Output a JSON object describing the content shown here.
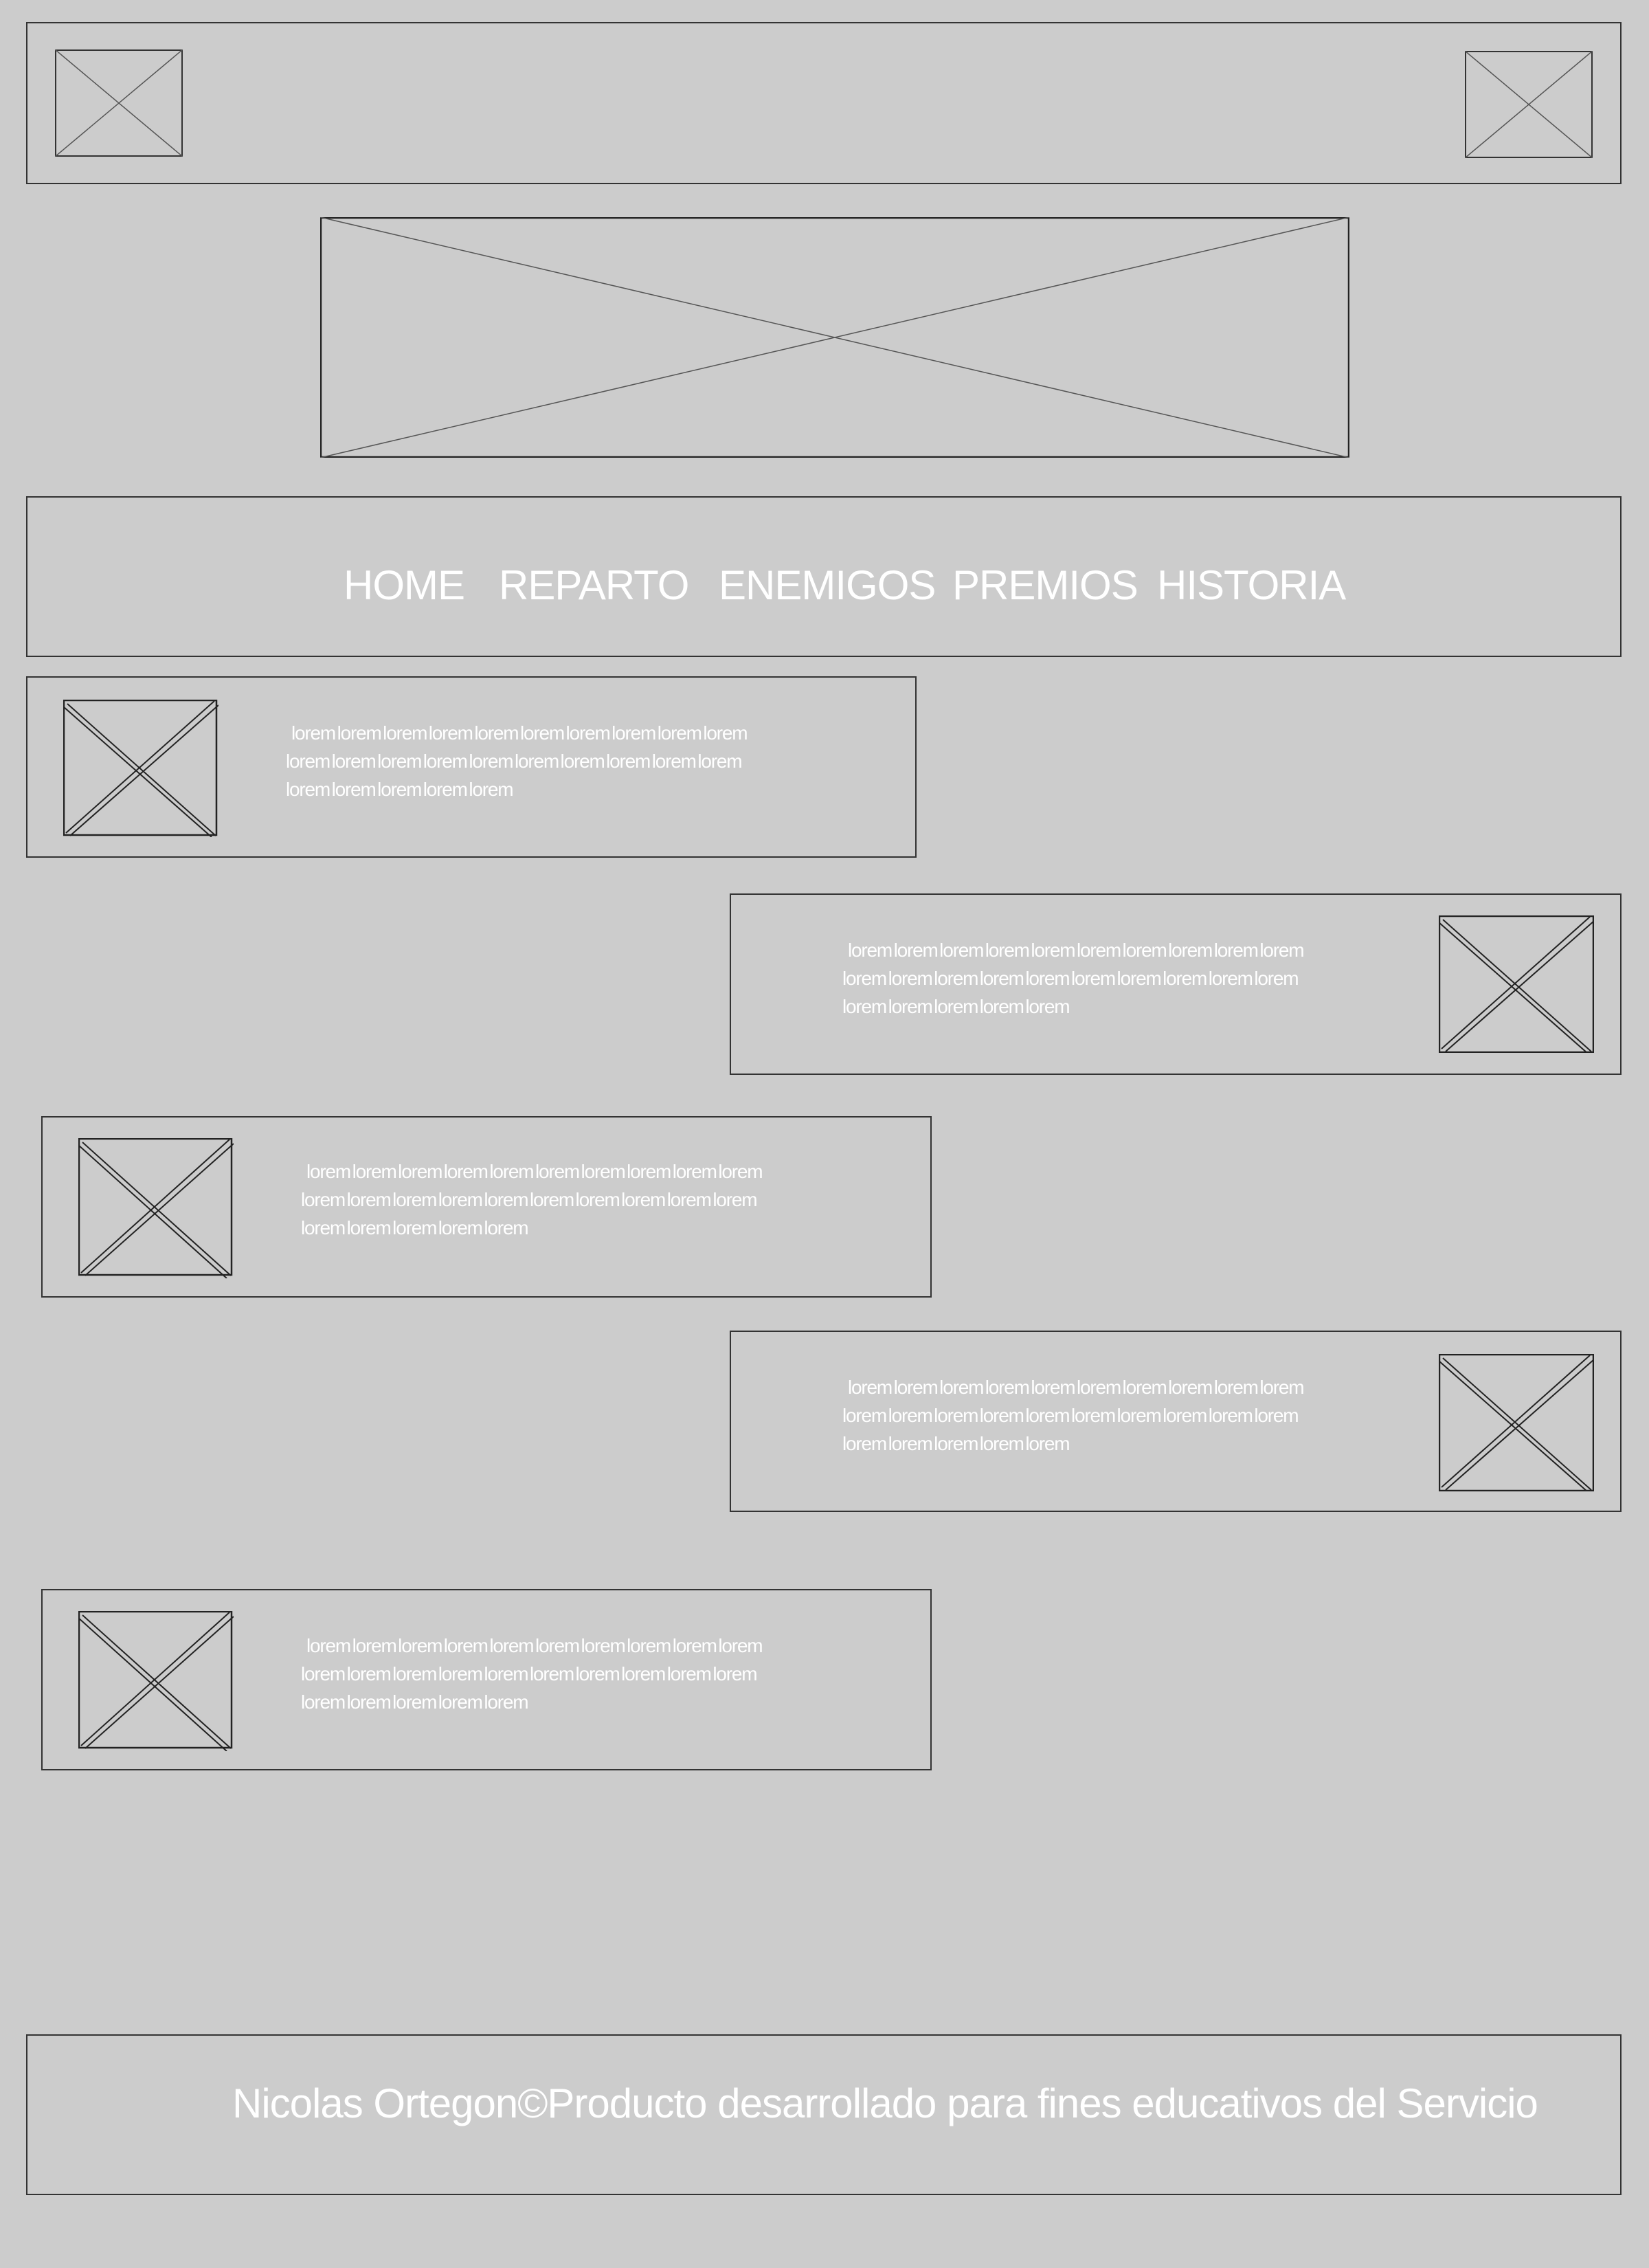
{
  "nav": {
    "home": "HOME",
    "reparto": "REPARTO",
    "enemigos": "ENEMIGOS",
    "premios": "PREMIOS",
    "historia": "HISTORIA"
  },
  "cards": [
    {
      "line1": "lorem  lorem lorem lorem lorem lorem lorem lorem lorem lorem",
      "line2": "lorem lorem lorem lorem lorem lorem lorem lorem lorem lorem",
      "line3": "lorem lorem lorem lorem lorem"
    },
    {
      "line1": "lorem  lorem lorem lorem lorem lorem lorem lorem lorem lorem",
      "line2": "lorem lorem lorem lorem lorem lorem lorem lorem lorem lorem",
      "line3": "lorem lorem lorem lorem lorem"
    },
    {
      "line1": "lorem  lorem lorem lorem lorem lorem lorem lorem lorem lorem",
      "line2": "lorem lorem lorem lorem lorem lorem lorem lorem lorem lorem",
      "line3": "lorem lorem lorem lorem lorem"
    },
    {
      "line1": "lorem  lorem lorem lorem lorem lorem lorem lorem lorem lorem",
      "line2": "lorem lorem lorem lorem lorem lorem lorem lorem lorem lorem",
      "line3": "lorem lorem lorem lorem lorem"
    },
    {
      "line1": "lorem  lorem lorem lorem lorem lorem lorem lorem lorem lorem",
      "line2": "lorem lorem lorem lorem lorem lorem lorem lorem lorem lorem",
      "line3": "lorem lorem lorem lorem lorem"
    }
  ],
  "footer": {
    "text": "Nicolas Ortegon©Producto desarrollado para fines educativos del Servicio"
  },
  "colors": {
    "background": "#cccccc",
    "border": "#333333",
    "text": "#ffffff"
  },
  "icons": {
    "placeholder": "image-placeholder-icon"
  }
}
